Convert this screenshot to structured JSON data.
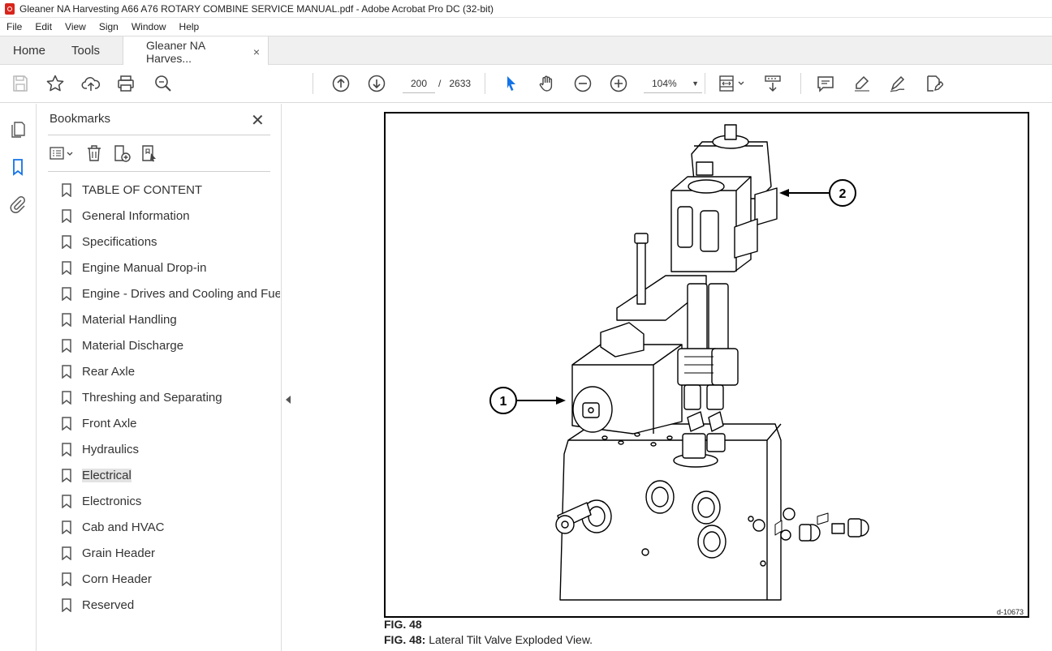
{
  "window": {
    "title": "Gleaner NA Harvesting A66  A76 ROTARY COMBINE SERVICE MANUAL.pdf - Adobe Acrobat Pro DC (32-bit)"
  },
  "menu": [
    "File",
    "Edit",
    "View",
    "Sign",
    "Window",
    "Help"
  ],
  "tabs": {
    "home": "Home",
    "tools": "Tools",
    "document": "Gleaner NA Harves...",
    "close_glyph": "×"
  },
  "toolbar": {
    "page_current": "200",
    "page_separator": "/",
    "page_total": "2633",
    "zoom": "104%",
    "icons": [
      "save-icon",
      "star-icon",
      "upload-icon",
      "print-icon",
      "search-zoom-icon",
      "page-up-icon",
      "page-down-icon",
      "select-cursor-icon",
      "hand-icon",
      "zoom-out-icon",
      "zoom-in-icon",
      "fit-page-icon",
      "scroll-mode-icon",
      "comment-icon",
      "highlight-icon",
      "draw-icon",
      "fill-sign-icon"
    ]
  },
  "bookmarks": {
    "title": "Bookmarks",
    "close_glyph": "✕",
    "items": [
      {
        "label": "TABLE OF CONTENT"
      },
      {
        "label": "General Information"
      },
      {
        "label": "Specifications"
      },
      {
        "label": "Engine Manual Drop-in"
      },
      {
        "label": "Engine - Drives and Cooling and Fuel"
      },
      {
        "label": "Material Handling"
      },
      {
        "label": "Material Discharge"
      },
      {
        "label": "Rear Axle"
      },
      {
        "label": "Threshing and Separating"
      },
      {
        "label": "Front Axle"
      },
      {
        "label": "Hydraulics"
      },
      {
        "label": "Electrical",
        "selected": true
      },
      {
        "label": "Electronics"
      },
      {
        "label": "Cab and HVAC"
      },
      {
        "label": "Grain Header"
      },
      {
        "label": "Corn Header"
      },
      {
        "label": "Reserved"
      }
    ]
  },
  "figure": {
    "callout_1": "1",
    "callout_2": "2",
    "code": "d-10673",
    "number": "FIG. 48",
    "caption_prefix": "FIG. 48:",
    "caption_text": " Lateral Tilt Valve Exploded View."
  }
}
